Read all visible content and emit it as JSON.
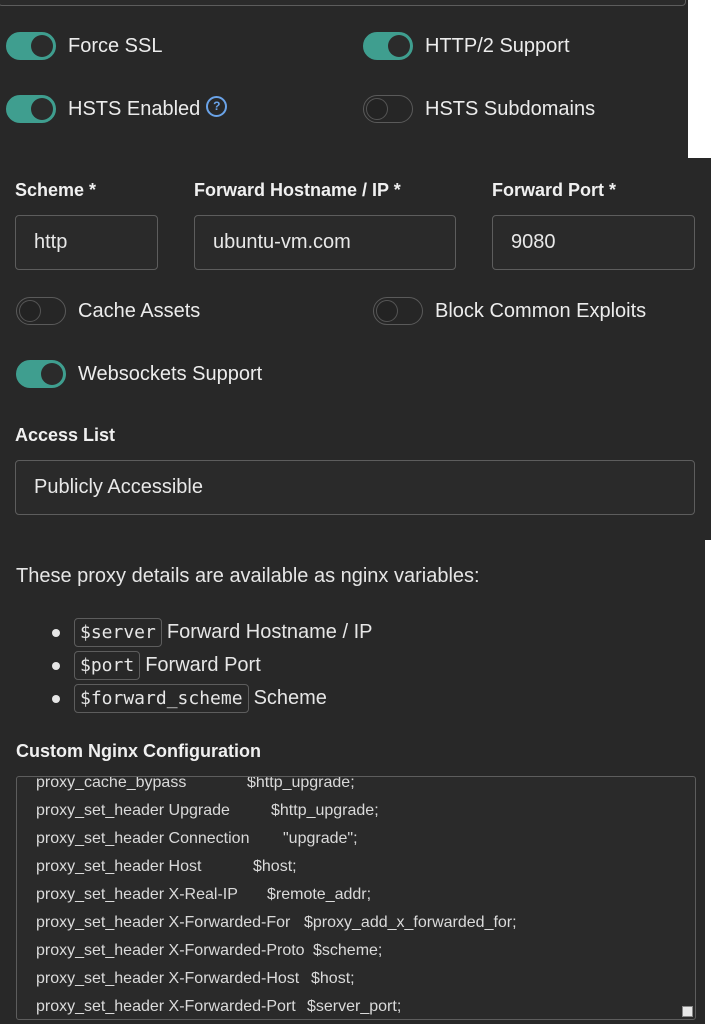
{
  "toggles": {
    "force_ssl": {
      "label": "Force SSL",
      "on": true
    },
    "http2": {
      "label": "HTTP/2 Support",
      "on": true
    },
    "hsts_enabled": {
      "label": "HSTS Enabled",
      "on": true
    },
    "hsts_subdomains": {
      "label": "HSTS Subdomains",
      "on": false
    },
    "cache_assets": {
      "label": "Cache Assets",
      "on": false
    },
    "block_exploits": {
      "label": "Block Common Exploits",
      "on": false
    },
    "websockets": {
      "label": "Websockets Support",
      "on": true
    }
  },
  "help_icon_glyph": "?",
  "fields": {
    "scheme": {
      "label": "Scheme *",
      "value": "http"
    },
    "hostname": {
      "label": "Forward Hostname / IP *",
      "value": "ubuntu-vm.com"
    },
    "port": {
      "label": "Forward Port *",
      "value": "9080"
    },
    "access_list": {
      "label": "Access List",
      "value": "Publicly Accessible"
    }
  },
  "info": {
    "intro": "These proxy details are available as nginx variables:",
    "variables": [
      {
        "code": "$server",
        "desc": "Forward Hostname / IP"
      },
      {
        "code": "$port",
        "desc": "Forward Port"
      },
      {
        "code": "$forward_scheme",
        "desc": "Scheme"
      }
    ]
  },
  "custom_config": {
    "label": "Custom Nginx Configuration",
    "lines": [
      {
        "key": "proxy_cache_bypass",
        "value": "$http_upgrade;"
      },
      {
        "key": "proxy_set_header Upgrade",
        "value": "$http_upgrade;"
      },
      {
        "key": "proxy_set_header Connection",
        "value": "\"upgrade\";"
      },
      {
        "key": "proxy_set_header Host",
        "value": "$host;"
      },
      {
        "key": "proxy_set_header X-Real-IP",
        "value": "$remote_addr;"
      },
      {
        "key": "proxy_set_header X-Forwarded-For",
        "value": "$proxy_add_x_forwarded_for;"
      },
      {
        "key": "proxy_set_header X-Forwarded-Proto",
        "value": "$scheme;"
      },
      {
        "key": "proxy_set_header X-Forwarded-Host",
        "value": "$host;"
      },
      {
        "key": "proxy_set_header X-Forwarded-Port",
        "value": "$server_port;"
      }
    ]
  },
  "colors": {
    "background": "#282828",
    "toggle_on": "#3f9e8f",
    "help_icon": "#6aa3e8"
  }
}
